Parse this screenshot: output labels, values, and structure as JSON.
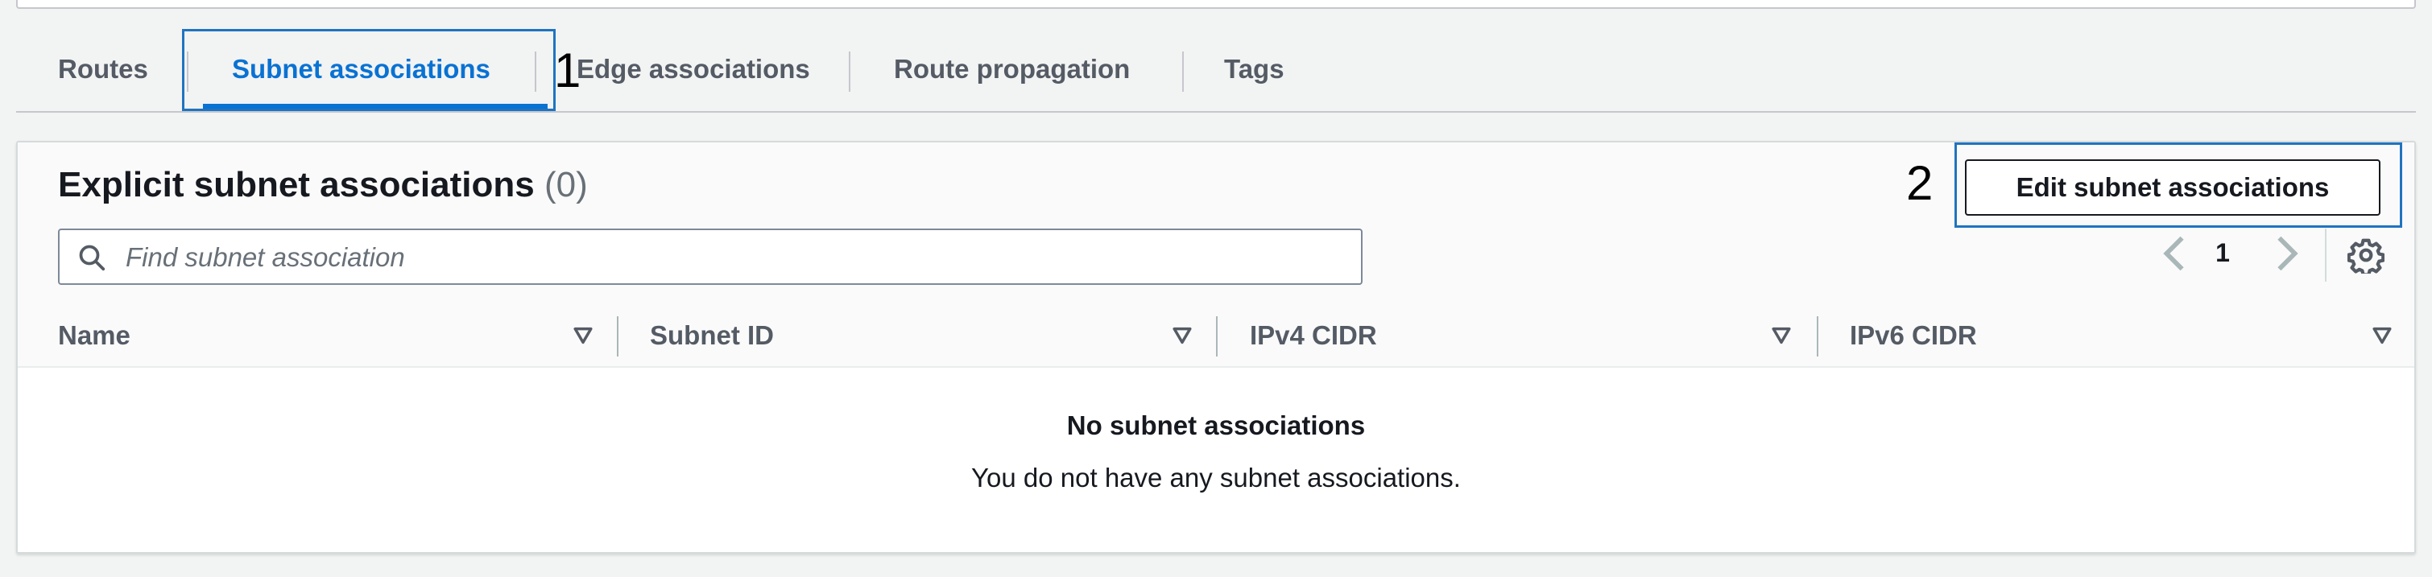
{
  "tabs": {
    "items": [
      {
        "label": "Routes"
      },
      {
        "label": "Subnet associations",
        "active": true
      },
      {
        "label": "Edge associations"
      },
      {
        "label": "Route propagation"
      },
      {
        "label": "Tags"
      }
    ]
  },
  "annotations": [
    "1",
    "2"
  ],
  "panel": {
    "title": "Explicit subnet associations",
    "count": "(0)",
    "edit_button_label": "Edit subnet associations",
    "search_placeholder": "Find subnet association",
    "search_value": "",
    "pagination": {
      "current_page": "1"
    }
  },
  "table": {
    "columns": [
      {
        "label": "Name"
      },
      {
        "label": "Subnet ID"
      },
      {
        "label": "IPv4 CIDR"
      },
      {
        "label": "IPv6 CIDR"
      }
    ],
    "rows": [],
    "empty_state": {
      "title": "No subnet associations",
      "description": "You do not have any subnet associations."
    }
  },
  "colors": {
    "accent": "#0972d3",
    "annotation_box": "#1f74c0",
    "text": "#16191f",
    "muted_text": "#545b64"
  },
  "icons": {
    "search": "search-icon",
    "prev": "chevron-left-icon",
    "next": "chevron-right-icon",
    "settings": "gear-icon",
    "sort": "sort-caret-down-icon"
  }
}
